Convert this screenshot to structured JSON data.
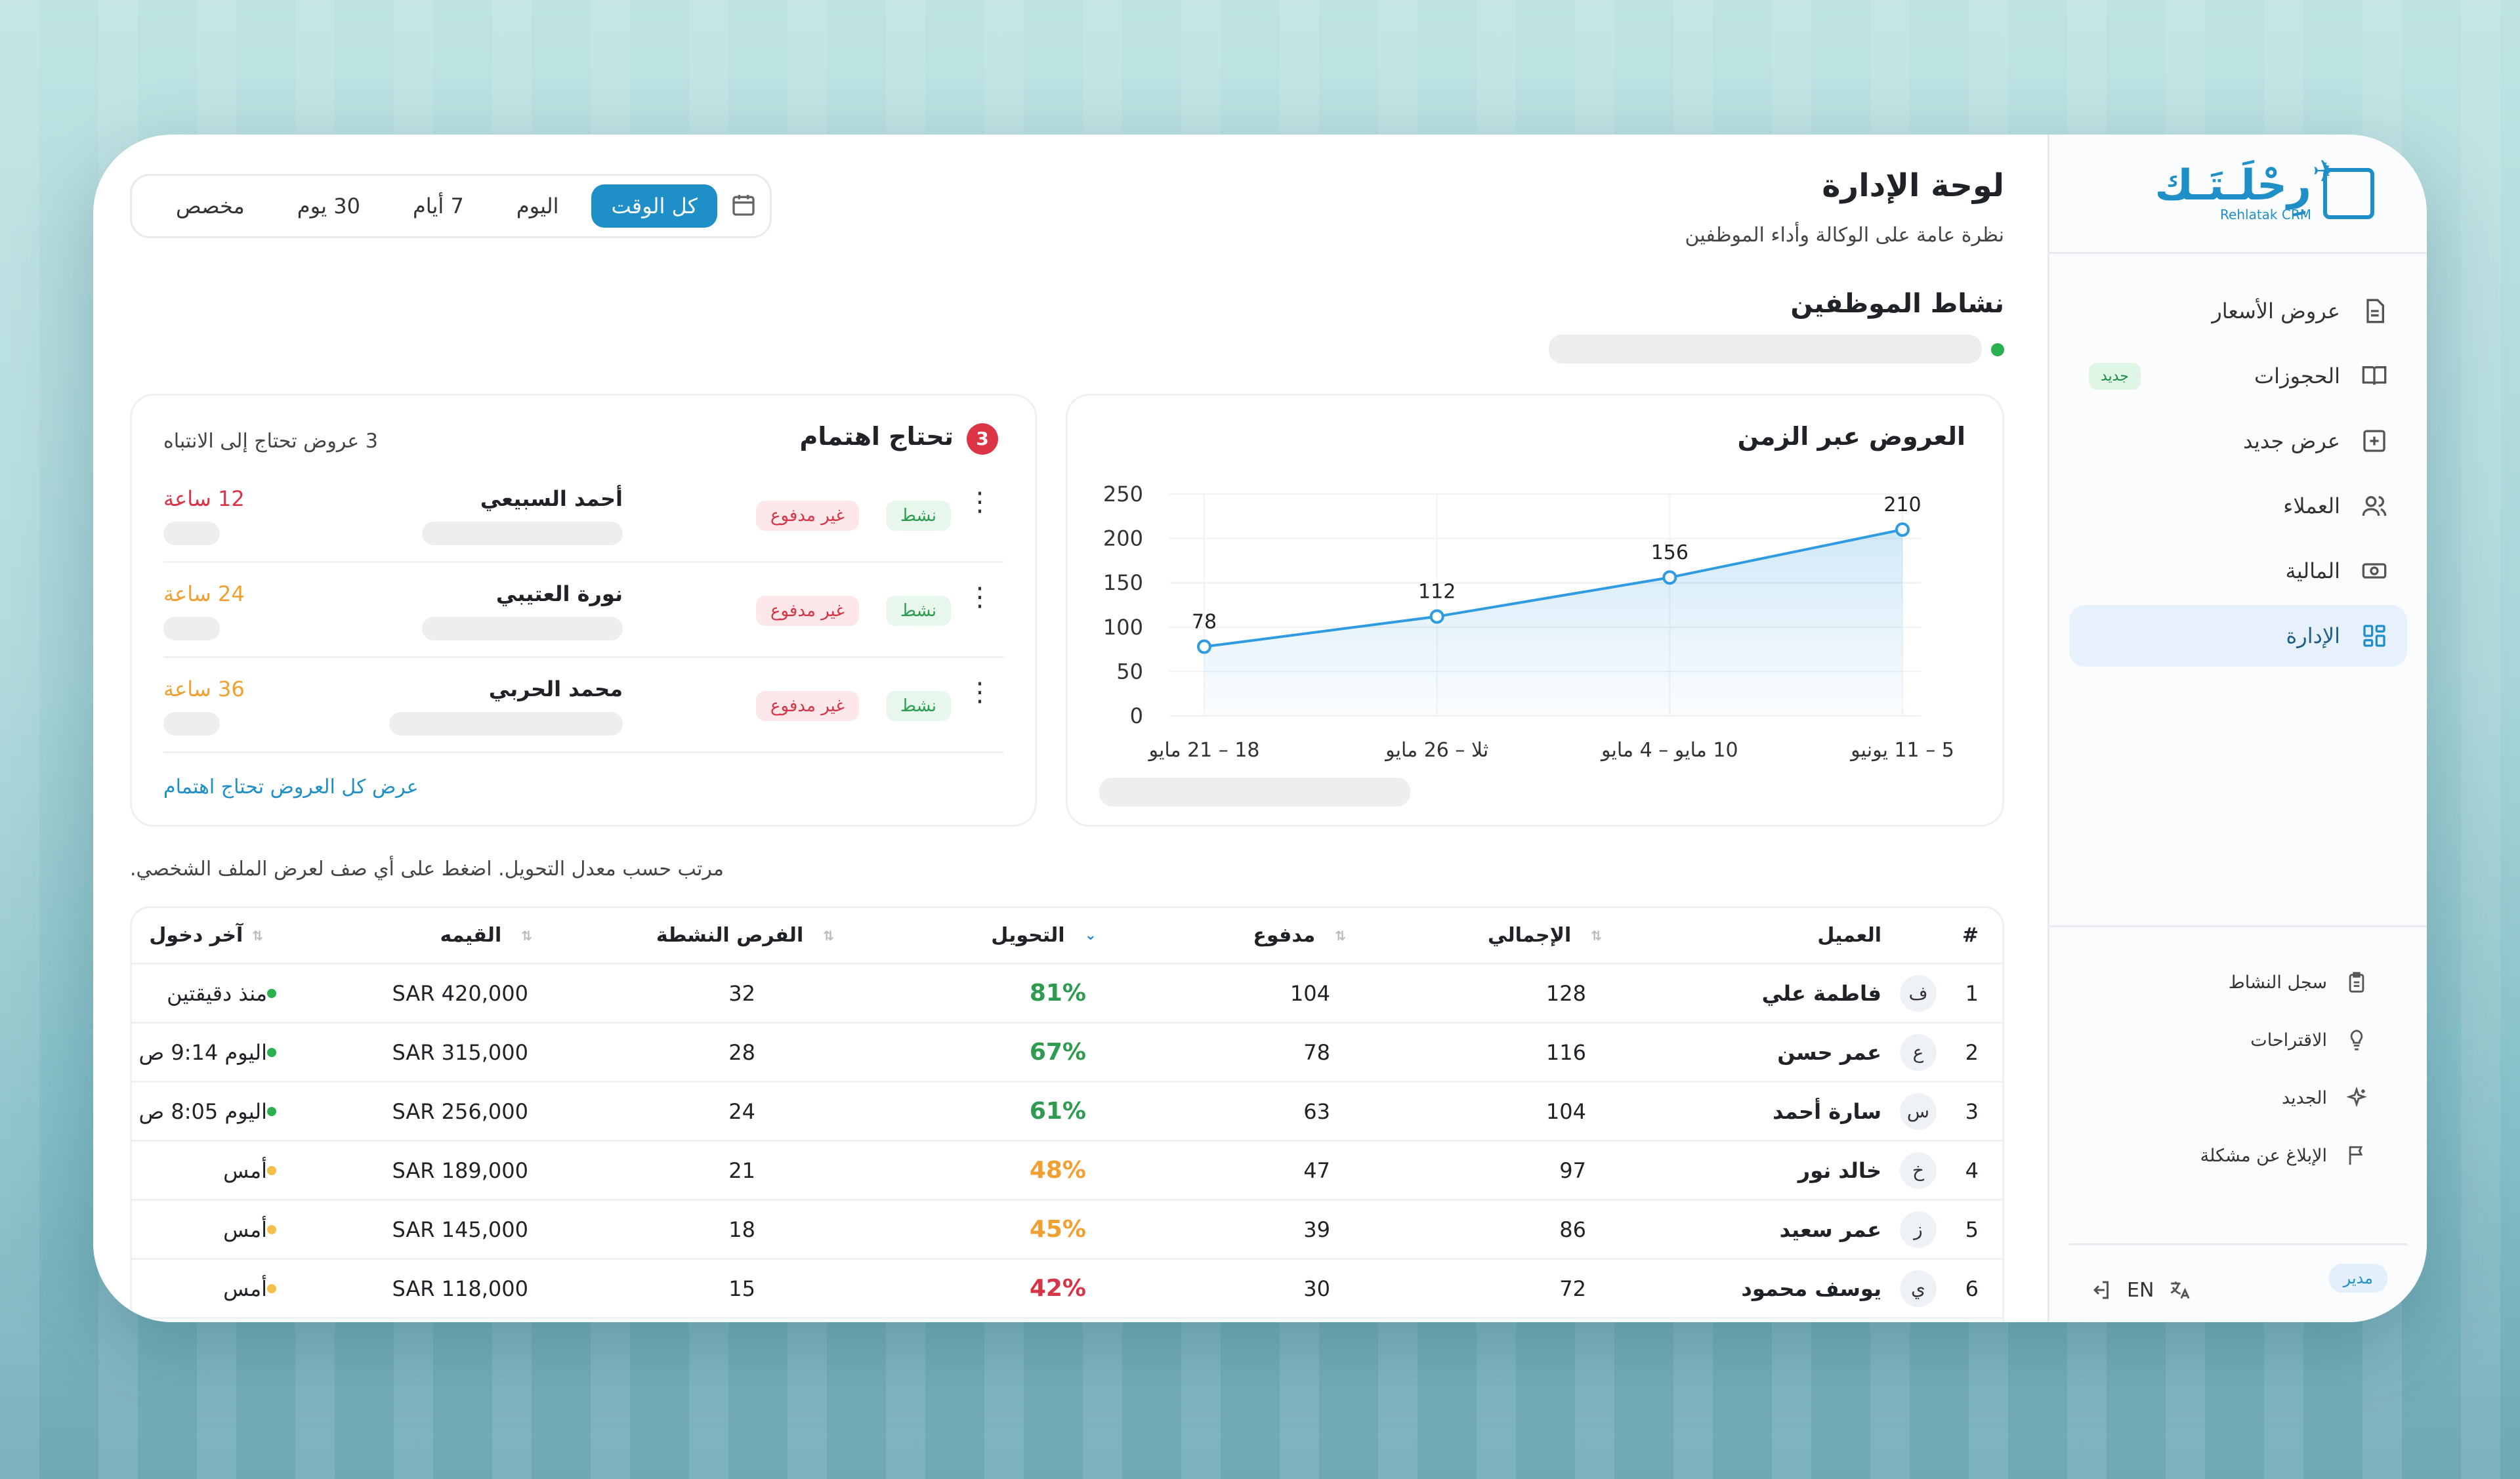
{
  "sidebar": {
    "logo_ar": "رِحْلَـتَـك",
    "logo_en": "Rehlatak CRM",
    "items": [
      {
        "label": "عروض الأسعار",
        "icon": "document-icon"
      },
      {
        "label": "الحجوزات",
        "icon": "book-icon",
        "badge": "جديد"
      },
      {
        "label": "عرض جديد",
        "icon": "plus-square-icon"
      },
      {
        "label": "العملاء",
        "icon": "users-icon"
      },
      {
        "label": "المالية",
        "icon": "cash-icon"
      },
      {
        "label": "الإدارة",
        "icon": "grid-icon",
        "active": true
      }
    ],
    "bottom_items": [
      {
        "label": "سجل النشاط",
        "icon": "clipboard-icon"
      },
      {
        "label": "الاقتراحات",
        "icon": "lightbulb-icon"
      },
      {
        "label": "الجديد",
        "icon": "sparkles-icon"
      },
      {
        "label": "الإبلاغ عن مشكلة",
        "icon": "flag-icon"
      }
    ],
    "role_badge": "مدير",
    "lang": "EN"
  },
  "header": {
    "title": "لوحة الإدارة",
    "subtitle": "نظرة عامة على الوكالة وأداء الموظفين"
  },
  "filters": {
    "options": [
      "كل الوقت",
      "اليوم",
      "7 أيام",
      "30 يوم",
      "مخصص"
    ],
    "selected": "كل الوقت"
  },
  "staff_activity": {
    "title": "نشاط الموظفين"
  },
  "chart_data": {
    "type": "line",
    "title": "العروض عبر الزمن",
    "categories": [
      "18 – 21 مايو",
      "ثلا – 26 مايو",
      "10 مايو – 4 مايو",
      "5 – 11 يونيو"
    ],
    "values": [
      78,
      112,
      156,
      210
    ],
    "ylim": [
      0,
      250
    ],
    "yticks": [
      0,
      50,
      100,
      150,
      200,
      250
    ],
    "grid": true,
    "color": "#2f9be0"
  },
  "attention": {
    "title": "تحتاج اهتمام",
    "count": "3",
    "subtitle": "3 عروض تحتاج إلى الانتباه",
    "link": "عرض كل العروض تحتاج اهتمام",
    "items": [
      {
        "name": "أحمد السبيعي",
        "time": "12 ساعة",
        "time_color": "#d63447",
        "status": "نشط",
        "payment": "غير مدفوع"
      },
      {
        "name": "نورة العتيبي",
        "time": "24 ساعة",
        "time_color": "#f0a030",
        "status": "نشط",
        "payment": "غير مدفوع"
      },
      {
        "name": "محمد الحربي",
        "time": "36 ساعة",
        "time_color": "#f0a030",
        "status": "نشط",
        "payment": "غير مدفوع"
      }
    ]
  },
  "table": {
    "hint": "مرتب حسب معدل التحويل. اضغط على أي صف لعرض الملف الشخصي.",
    "headers": {
      "num": "#",
      "client": "العميل",
      "total": "الإجمالي",
      "paid": "مدفوع",
      "conversion": "التحويل",
      "active": "الفرص النشطة",
      "value": "القيمه",
      "last": "آخر دخول"
    },
    "rows": [
      {
        "num": "1",
        "initial": "ف",
        "name": "فاطمة علي",
        "total": "128",
        "paid": "104",
        "conv": "81%",
        "conv_color": "#2e9b50",
        "active": "32",
        "value": "SAR 420,000",
        "last": "منذ دقيقتين",
        "dot": "#2ab04f"
      },
      {
        "num": "2",
        "initial": "ع",
        "name": "عمر حسن",
        "total": "116",
        "paid": "78",
        "conv": "67%",
        "conv_color": "#2e9b50",
        "active": "28",
        "value": "SAR 315,000",
        "last": "اليوم 9:14 ص",
        "dot": "#2ab04f"
      },
      {
        "num": "3",
        "initial": "س",
        "name": "سارة أحمد",
        "total": "104",
        "paid": "63",
        "conv": "61%",
        "conv_color": "#2e9b50",
        "active": "24",
        "value": "SAR 256,000",
        "last": "اليوم 8:05 ص",
        "dot": "#2ab04f"
      },
      {
        "num": "4",
        "initial": "خ",
        "name": "خالد نور",
        "total": "97",
        "paid": "47",
        "conv": "48%",
        "conv_color": "#f0a030",
        "active": "21",
        "value": "SAR 189,000",
        "last": "أمس",
        "dot": "#f5c04a"
      },
      {
        "num": "5",
        "initial": "ز",
        "name": "عمر سعيد",
        "total": "86",
        "paid": "39",
        "conv": "45%",
        "conv_color": "#f0a030",
        "active": "18",
        "value": "SAR 145,000",
        "last": "أمس",
        "dot": "#f5c04a"
      },
      {
        "num": "6",
        "initial": "ي",
        "name": "يوسف محمود",
        "total": "72",
        "paid": "30",
        "conv": "42%",
        "conv_color": "#d63447",
        "active": "15",
        "value": "SAR 118,000",
        "last": "أمس",
        "dot": "#f5c04a"
      }
    ]
  }
}
